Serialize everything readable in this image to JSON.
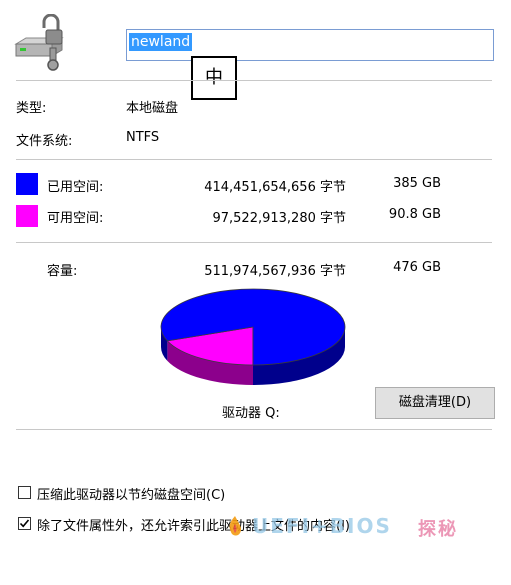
{
  "header": {
    "drive_name": "newland",
    "ime_indicator": "中",
    "drive_icon": "locked-drive-icon"
  },
  "info": {
    "type_label": "类型:",
    "type_value": "本地磁盘",
    "fs_label": "文件系统:",
    "fs_value": "NTFS"
  },
  "space": {
    "used": {
      "label": "已用空间:",
      "bytes": "414,451,654,656 字节",
      "size": "385 GB",
      "color": "#0000ff"
    },
    "free": {
      "label": "可用空间:",
      "bytes": "97,522,913,280 字节",
      "size": "90.8 GB",
      "color": "#ff00ff"
    },
    "capacity": {
      "label": "容量:",
      "bytes": "511,974,567,936 字节",
      "size": "476 GB"
    }
  },
  "chart_data": {
    "type": "pie",
    "categories": [
      "已用空间",
      "可用空间"
    ],
    "values": [
      414451654656,
      97522913280
    ],
    "colors": [
      "#0000ff",
      "#ff00ff"
    ]
  },
  "drive_label": "驱动器 Q:",
  "cleanup_button": "磁盘清理(D)",
  "options": {
    "compress": {
      "label": "压缩此驱动器以节约磁盘空间(C)",
      "checked": false
    },
    "index": {
      "label": "除了文件属性外，还允许索引此驱动器上文件的内容(I)",
      "checked": true
    }
  },
  "watermark": "UEFI+BIOS探秘"
}
